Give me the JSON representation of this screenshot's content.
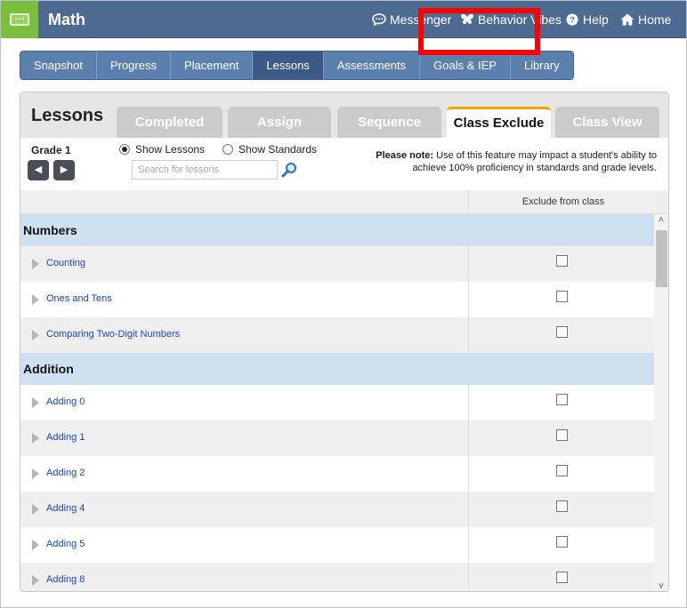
{
  "app": {
    "title": "Math"
  },
  "topnav": {
    "messenger": "Messenger",
    "behavior_vibes": "Behavior Vibes",
    "help": "Help",
    "home": "Home"
  },
  "tabs": [
    {
      "label": "Snapshot"
    },
    {
      "label": "Progress"
    },
    {
      "label": "Placement"
    },
    {
      "label": "Lessons",
      "active": true
    },
    {
      "label": "Assessments"
    },
    {
      "label": "Goals & IEP"
    },
    {
      "label": "Library"
    }
  ],
  "panel": {
    "title": "Lessons",
    "subtabs": [
      {
        "label": "Completed"
      },
      {
        "label": "Assign"
      },
      {
        "label": "Sequence"
      },
      {
        "label": "Class Exclude",
        "active": true
      },
      {
        "label": "Class View"
      }
    ]
  },
  "controls": {
    "grade": "Grade 1",
    "prev_arrow": "◀",
    "next_arrow": "▶",
    "radio_lessons": "Show Lessons",
    "radio_standards": "Show Standards",
    "selected_radio": "Show Lessons",
    "search_placeholder": "Search for lessons",
    "note_bold": "Please note:",
    "note_text": " Use of this feature may impact a student's ability to achieve 100% proficiency in standards and grade levels."
  },
  "table": {
    "column_header": "Exclude from class",
    "sections": [
      {
        "title": "Numbers",
        "rows": [
          "Counting",
          "Ones and Tens",
          "Comparing Two-Digit Numbers"
        ]
      },
      {
        "title": "Addition",
        "rows": [
          "Adding 0",
          "Adding 1",
          "Adding 2",
          "Adding 4",
          "Adding 5",
          "Adding 8"
        ]
      }
    ]
  },
  "colors": {
    "topbar": "#4d6a93",
    "logo": "#7cbf3c",
    "nav_tab": "#5b80ad",
    "nav_tab_active": "#3b5a86",
    "section_bg": "#cfe0f0",
    "link": "#1a45c8",
    "highlight": "#ff0000",
    "active_tab_accent": "#f0a500"
  }
}
